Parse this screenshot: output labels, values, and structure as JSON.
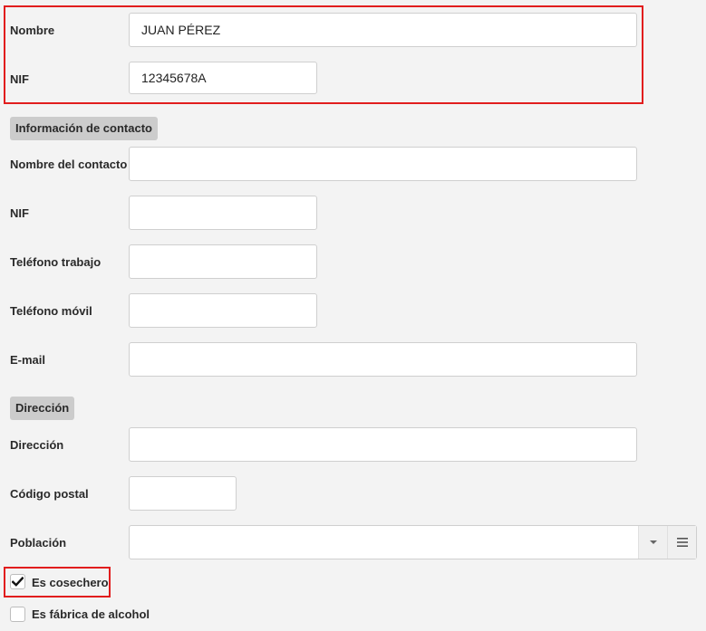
{
  "identity": {
    "name_label": "Nombre",
    "name_value": "JUAN PÉREZ",
    "nif_label": "NIF",
    "nif_value": "12345678A"
  },
  "contact_section": {
    "title": "Información de contacto",
    "contact_name_label": "Nombre del contacto",
    "contact_name_value": "",
    "nif_label": "NIF",
    "nif_value": "",
    "work_phone_label": "Teléfono trabajo",
    "work_phone_value": "",
    "mobile_phone_label": "Teléfono móvil",
    "mobile_phone_value": "",
    "email_label": "E-mail",
    "email_value": ""
  },
  "address_section": {
    "title": "Dirección",
    "address_label": "Dirección",
    "address_value": "",
    "postal_code_label": "Código postal",
    "postal_code_value": "",
    "town_label": "Población",
    "town_value": ""
  },
  "options": {
    "es_cosechero_label": "Es cosechero",
    "es_cosechero_checked": true,
    "es_fabrica_label": "Es fábrica de alcohol",
    "es_fabrica_checked": false
  },
  "colors": {
    "highlight": "#e11d1d",
    "background": "#f3f3f3",
    "section_chip": "#cccccc"
  },
  "icons": {
    "dropdown": "caret-down-icon",
    "list": "list-menu-icon",
    "check": "check-icon"
  }
}
